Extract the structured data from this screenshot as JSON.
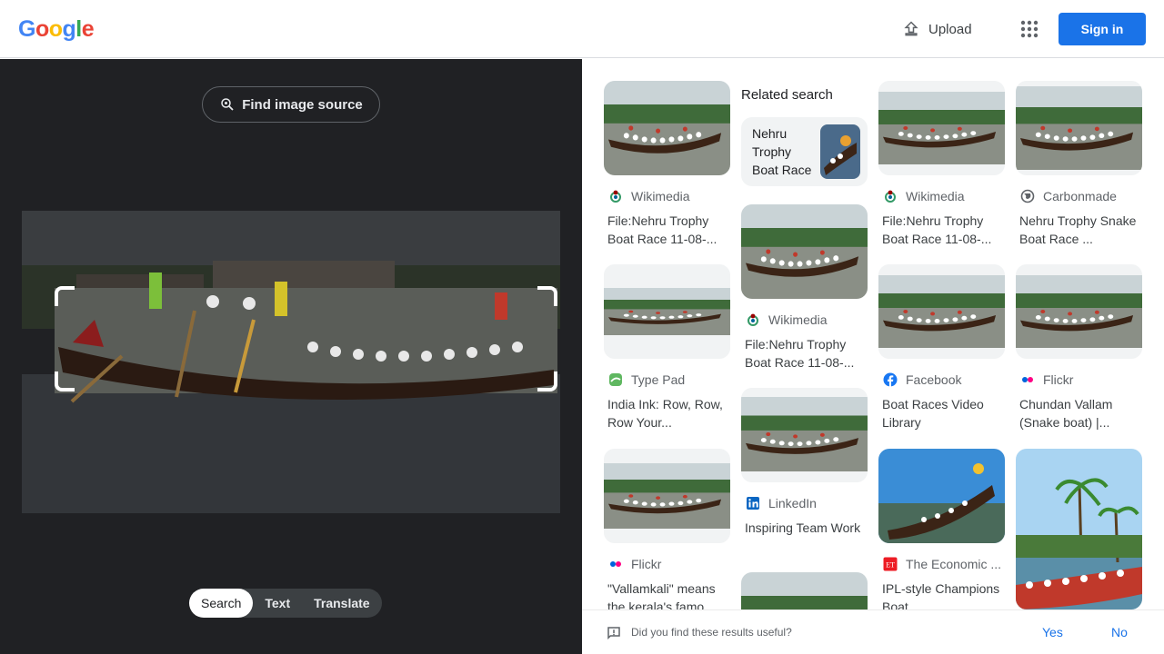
{
  "header": {
    "logo_letters": [
      "G",
      "o",
      "o",
      "g",
      "l",
      "e"
    ],
    "upload_label": "Upload",
    "apps_icon": "apps-grid-icon",
    "signin_label": "Sign in"
  },
  "lens": {
    "find_source_label": "Find image source",
    "modes": [
      "Search",
      "Text",
      "Translate"
    ],
    "active_mode": "Search"
  },
  "related": {
    "label": "Related search",
    "query": "Nehru Trophy Boat Race"
  },
  "results": [
    {
      "source": "Wikimedia",
      "title": "File:Nehru Trophy Boat Race 11-08-...",
      "favicon": "wikimedia-icon"
    },
    {
      "source": "Type Pad",
      "title": "India Ink: Row, Row, Row Your...",
      "favicon": "typepad-icon"
    },
    {
      "source": "Flickr",
      "title": "\"Vallamkali\" means the kerala's famo...",
      "favicon": "flickr-icon"
    },
    {
      "source": "Wikimedia",
      "title": "File:Nehru Trophy Boat Race 11-08-...",
      "favicon": "wikimedia-icon"
    },
    {
      "source": "LinkedIn",
      "title": "Inspiring Team Work",
      "favicon": "linkedin-icon"
    },
    {
      "source": "Wikimedia",
      "title": "File:Nehru Trophy Boat Race 11-08-...",
      "favicon": "wikimedia-icon"
    },
    {
      "source": "Facebook",
      "title": "Boat Races Video Library",
      "favicon": "facebook-icon"
    },
    {
      "source": "The Economic ...",
      "title": "IPL-style Champions Boat...",
      "favicon": "economic-times-icon"
    },
    {
      "source": "Carbonmade",
      "title": "Nehru Trophy Snake Boat Race ...",
      "favicon": "globe-icon"
    },
    {
      "source": "Flickr",
      "title": "Chundan Vallam (Snake boat) |...",
      "favicon": "flickr-icon"
    }
  ],
  "feedback": {
    "question": "Did you find these results useful?",
    "yes": "Yes",
    "no": "No"
  },
  "colors": {
    "brand_blue": "#1a73e8",
    "dark_pane": "#202124"
  }
}
